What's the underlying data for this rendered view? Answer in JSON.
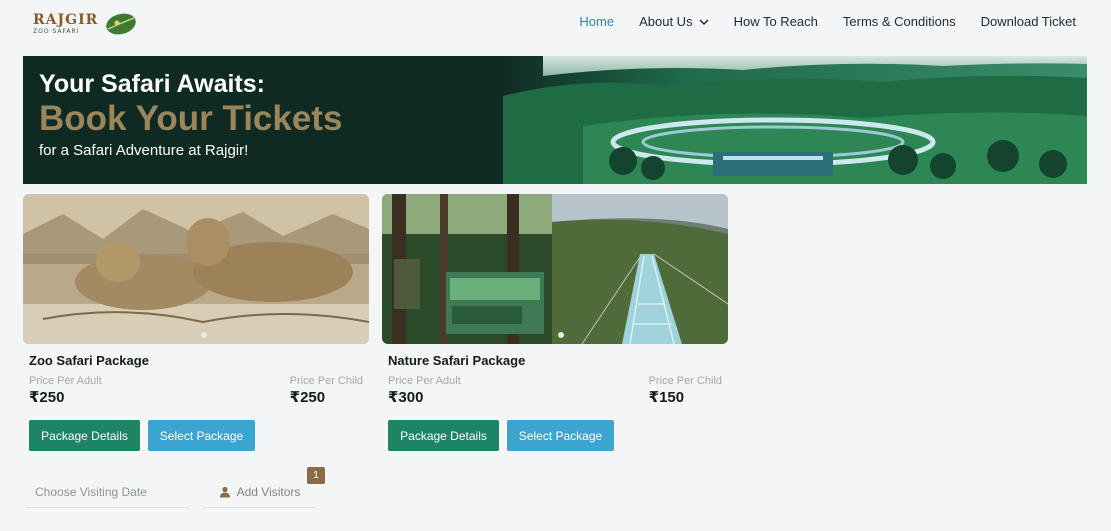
{
  "header": {
    "logo_title": "RAJGIR",
    "logo_subtitle": "ZOO SAFARI"
  },
  "nav": {
    "items": [
      {
        "label": "Home",
        "active": true
      },
      {
        "label": "About Us",
        "has_dropdown": true
      },
      {
        "label": "How To Reach"
      },
      {
        "label": "Terms & Conditions"
      },
      {
        "label": "Download Ticket"
      }
    ]
  },
  "banner": {
    "line1": "Your Safari Awaits:",
    "line2": "Book Your Tickets",
    "line3": "for a Safari Adventure at Rajgir!"
  },
  "packages": [
    {
      "title": "Zoo Safari Package",
      "adult_label": "Price Per Adult",
      "adult_price": "₹250",
      "child_label": "Price Per Child",
      "child_price": "₹250",
      "details_label": "Package Details",
      "select_label": "Select Package"
    },
    {
      "title": "Nature Safari Package",
      "adult_label": "Price Per Adult",
      "adult_price": "₹300",
      "child_label": "Price Per Child",
      "child_price": "₹150",
      "details_label": "Package Details",
      "select_label": "Select Package"
    }
  ],
  "booking": {
    "date_placeholder": "Choose Visiting Date",
    "visitors_label": "Add Visitors",
    "visitors_count": "1"
  },
  "colors": {
    "accent": "#2a8aa8",
    "primary_button": "#1d8466",
    "secondary_button": "#3ba4cf",
    "banner_gold": "#9b855a",
    "badge": "#8a6d46"
  },
  "icons": {
    "logo": "rajgir-zoo-safari-logo",
    "leaf": "leaf-icon",
    "dropdown": "chevron-down-icon",
    "visitors": "person-icon"
  }
}
